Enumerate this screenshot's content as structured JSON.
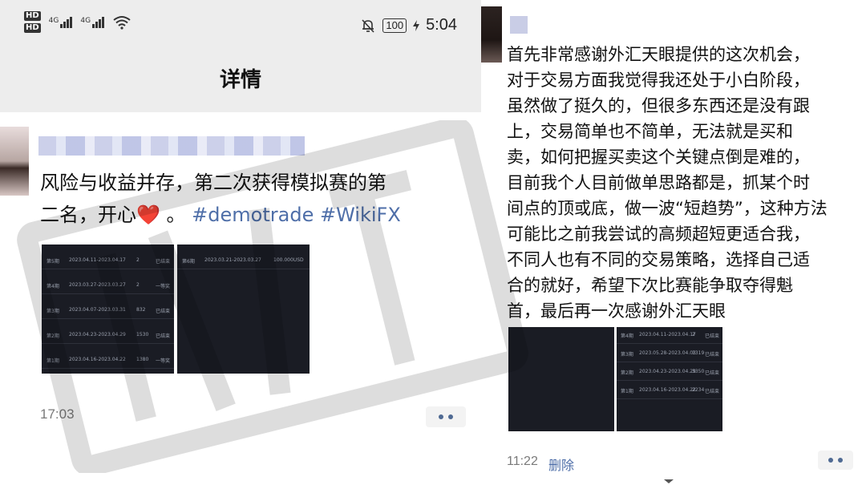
{
  "left": {
    "status": {
      "hd1": "HD",
      "hd2": "HD",
      "net1": "4G",
      "net2": "4G",
      "battery": "100",
      "time": "5:04"
    },
    "title": "详情",
    "post": {
      "text_line1": "风险与收益并存，第二次获得模拟赛的第",
      "text_line2_prefix": "二名，开心",
      "heart": "❤️",
      "text_line2_mid": " 。",
      "hashtag1": "#demotrade",
      "hashtag2": "#WikiFX",
      "time": "17:03"
    }
  },
  "right": {
    "post": {
      "lines": [
        "首先非常感谢外汇天眼提供的这次机会，",
        "对于交易方面我觉得我还处于小白阶段，",
        "虽然做了挺久的，但很多东西还是没有跟",
        "上，交易简单也不简单，无法就是买和",
        "卖，如何把握买卖这个关键点倒是难的，",
        "目前我个人目前做单思路都是，抓某个时",
        "间点的顶或底，做一波“短趋势”，这种方法",
        "可能比之前我尝试的高频超短更适合我，",
        "不同人也有不同的交易策略，选择自己适",
        "合的就好，希望下次比赛能争取夺得魁",
        "首，最后再一次感谢外汇天眼"
      ],
      "time": "11:22",
      "delete_label": "删除"
    }
  },
  "thumbs": {
    "left_a_rows": [
      [
        "第5期",
        "2023.04.11-2023.04.17",
        "2",
        "已结束"
      ],
      [
        "第4期",
        "2023.03.27-2023.03.27",
        "2",
        "一等奖"
      ],
      [
        "第3期",
        "2023.04.07-2023.03.31",
        "832",
        "已结束"
      ],
      [
        "第2期",
        "2023.04.23-2023.04.29",
        "1530",
        "已结束"
      ],
      [
        "第1期",
        "2023.04.16-2023.04.22",
        "1380",
        "一等奖"
      ]
    ],
    "left_b_rows": [
      [
        "第6期",
        "2023.03.21-2023.03.27",
        "100.000USD"
      ]
    ],
    "right_b_rows": [
      [
        "第4期",
        "2023.04.11-2023.04.17",
        "2",
        "已结束"
      ],
      [
        "第3期",
        "2023.05.28-2023.04.03",
        "1319",
        "已结束"
      ],
      [
        "第2期",
        "2023.04.23-2023.04.29",
        "3350",
        "已结束"
      ],
      [
        "第1期",
        "2023.04.16-2023.04.22",
        "2234",
        "已结束"
      ]
    ]
  },
  "colors": {
    "hashtag": "#4e6ea8",
    "header_bg": "#ededed",
    "thumb_bg": "#1a1c24"
  }
}
